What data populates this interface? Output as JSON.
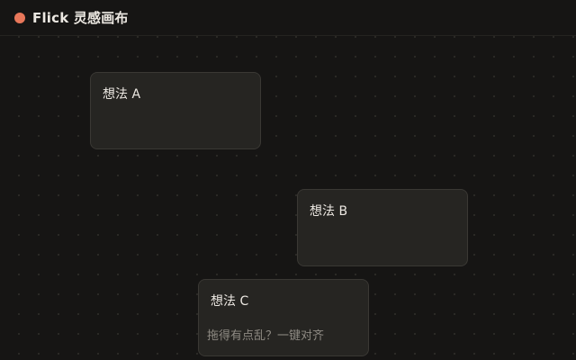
{
  "app": {
    "title": "Flick 灵感画布",
    "accent_color": "#e8775a",
    "logo_icon": "orange-dot-icon"
  },
  "canvas": {
    "background": "#161514",
    "dot_grid": true,
    "cards": [
      {
        "label": "想法 A"
      },
      {
        "label": "想法 B"
      },
      {
        "label": "想法 C",
        "hint": "拖得有点乱？一键对齐"
      }
    ]
  }
}
